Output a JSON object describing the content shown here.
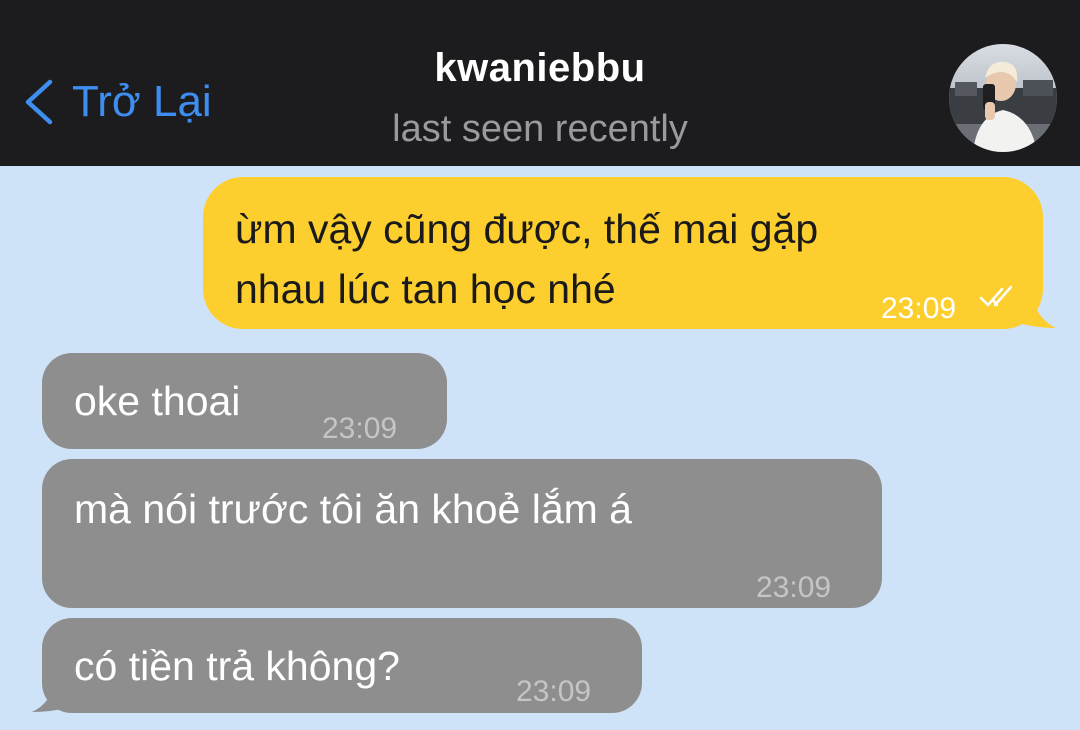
{
  "header": {
    "back_label": "Trở Lại",
    "contact_name": "kwaniebbu",
    "contact_status": "last seen recently",
    "avatar_icon": "contact-avatar-photo"
  },
  "messages": [
    {
      "direction": "outgoing",
      "text": "ừm vậy cũng được, thế mai gặp\nnhau lúc tan học nhé",
      "time": "23:09",
      "status_icon": "double-check-icon"
    },
    {
      "direction": "incoming",
      "text": "oke thoai",
      "time": "23:09"
    },
    {
      "direction": "incoming",
      "text": "mà nói trước tôi ăn khoẻ lắm á",
      "time": "23:09"
    },
    {
      "direction": "incoming",
      "text": "có tiền trả không?",
      "time": "23:09"
    }
  ],
  "colors": {
    "header_bg": "#1c1c1e",
    "chat_bg": "#cfe3f8",
    "accent": "#3d8ef0",
    "outgoing_bubble": "#fdcf2e",
    "incoming_bubble": "#8e8e8e"
  }
}
